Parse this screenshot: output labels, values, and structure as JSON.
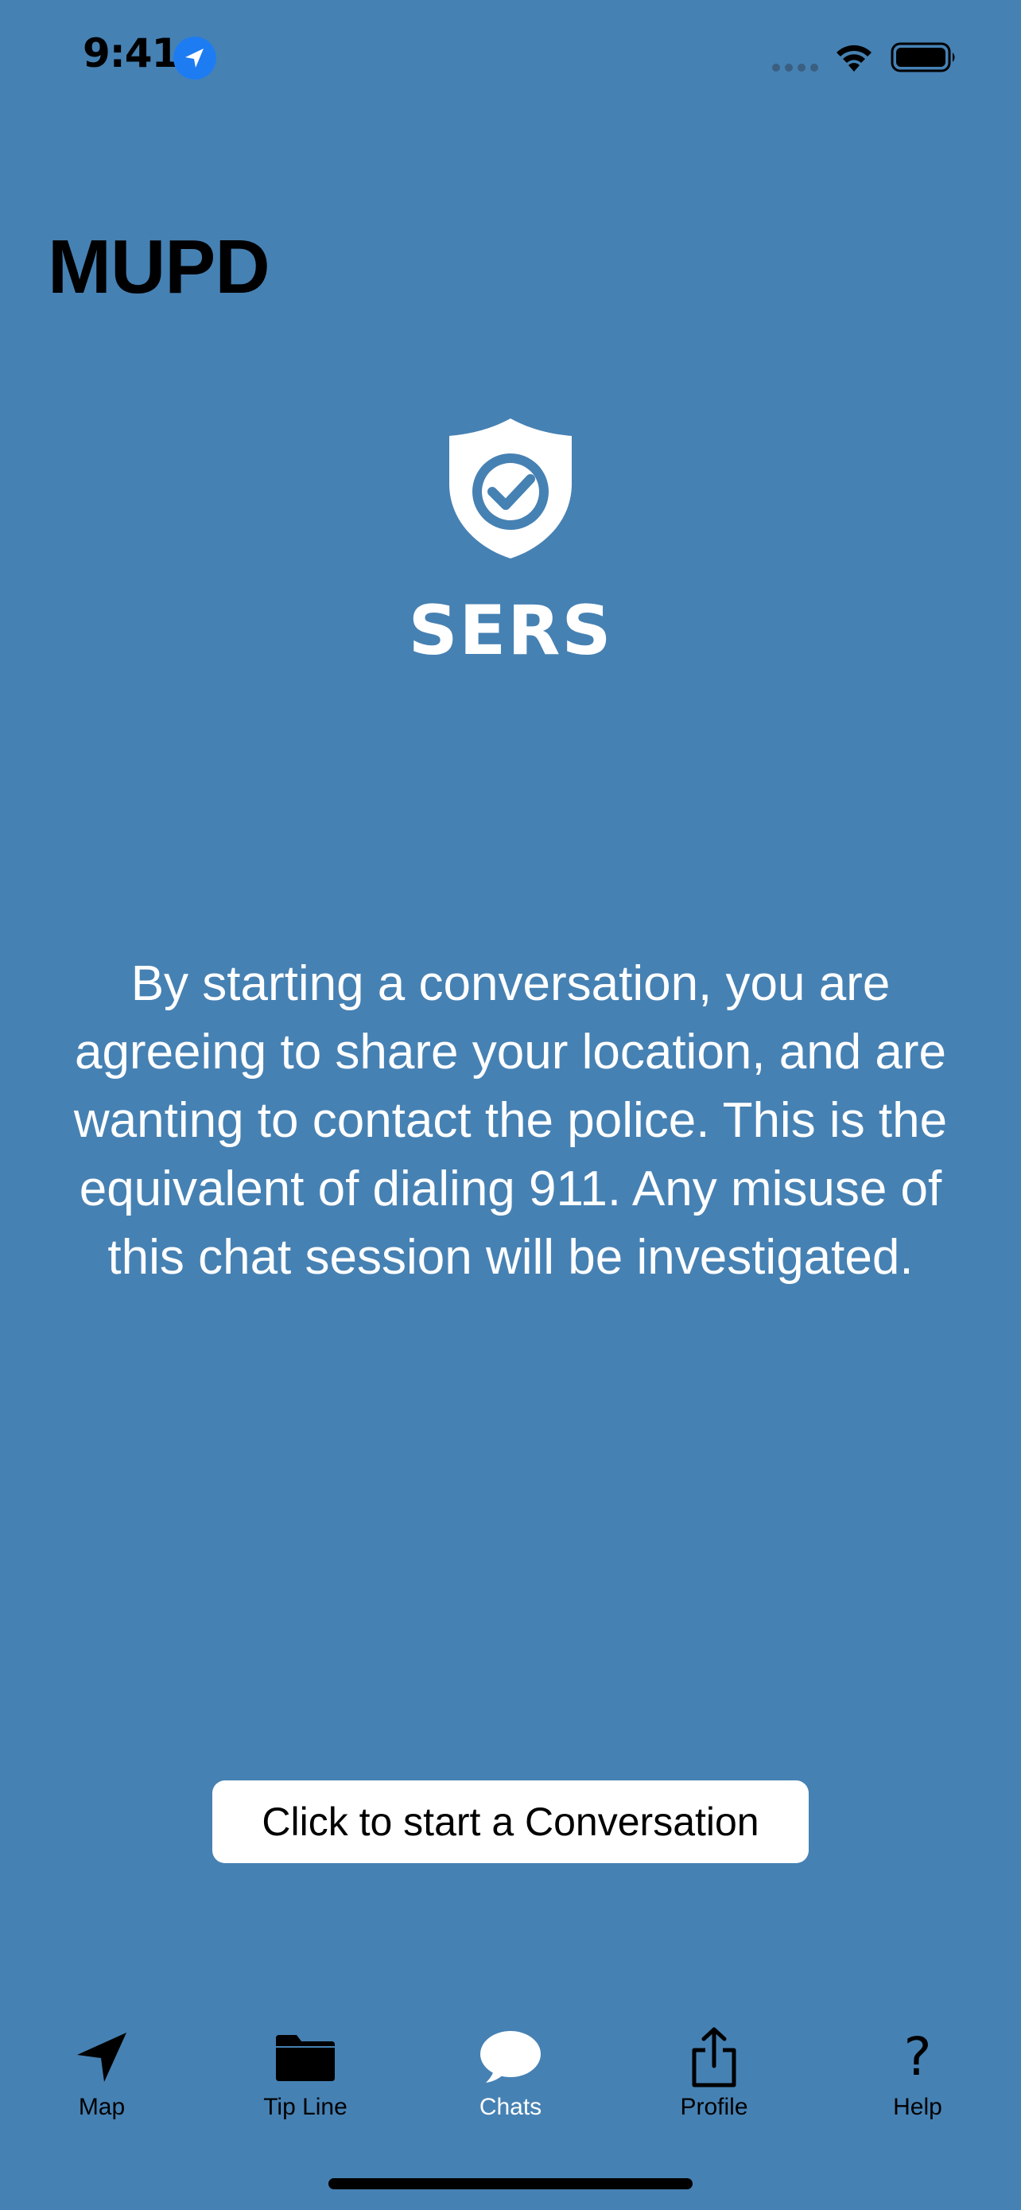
{
  "status_bar": {
    "time": "9:41"
  },
  "header": {
    "title": "MUPD"
  },
  "logo": {
    "text": "SERS"
  },
  "disclaimer": {
    "text": "By starting a conversation, you are agreeing to share your location, and are wanting to contact the police. This is the equivalent of dialing 911. Any misuse of this chat session will be investigated."
  },
  "start_button": {
    "label": "Click to start a Conversation"
  },
  "tab_bar": {
    "items": [
      {
        "label": "Map",
        "icon": "navigation-arrow-icon",
        "active": false
      },
      {
        "label": "Tip Line",
        "icon": "folder-icon",
        "active": false
      },
      {
        "label": "Chats",
        "icon": "chat-bubble-icon",
        "active": true
      },
      {
        "label": "Profile",
        "icon": "share-icon",
        "active": false
      },
      {
        "label": "Help",
        "icon": "question-mark-icon",
        "active": false
      }
    ]
  },
  "colors": {
    "background": "#4681B3",
    "active_tab": "#FFFFFF",
    "inactive_tab": "#000000",
    "location_badge": "#1E7CF2"
  }
}
